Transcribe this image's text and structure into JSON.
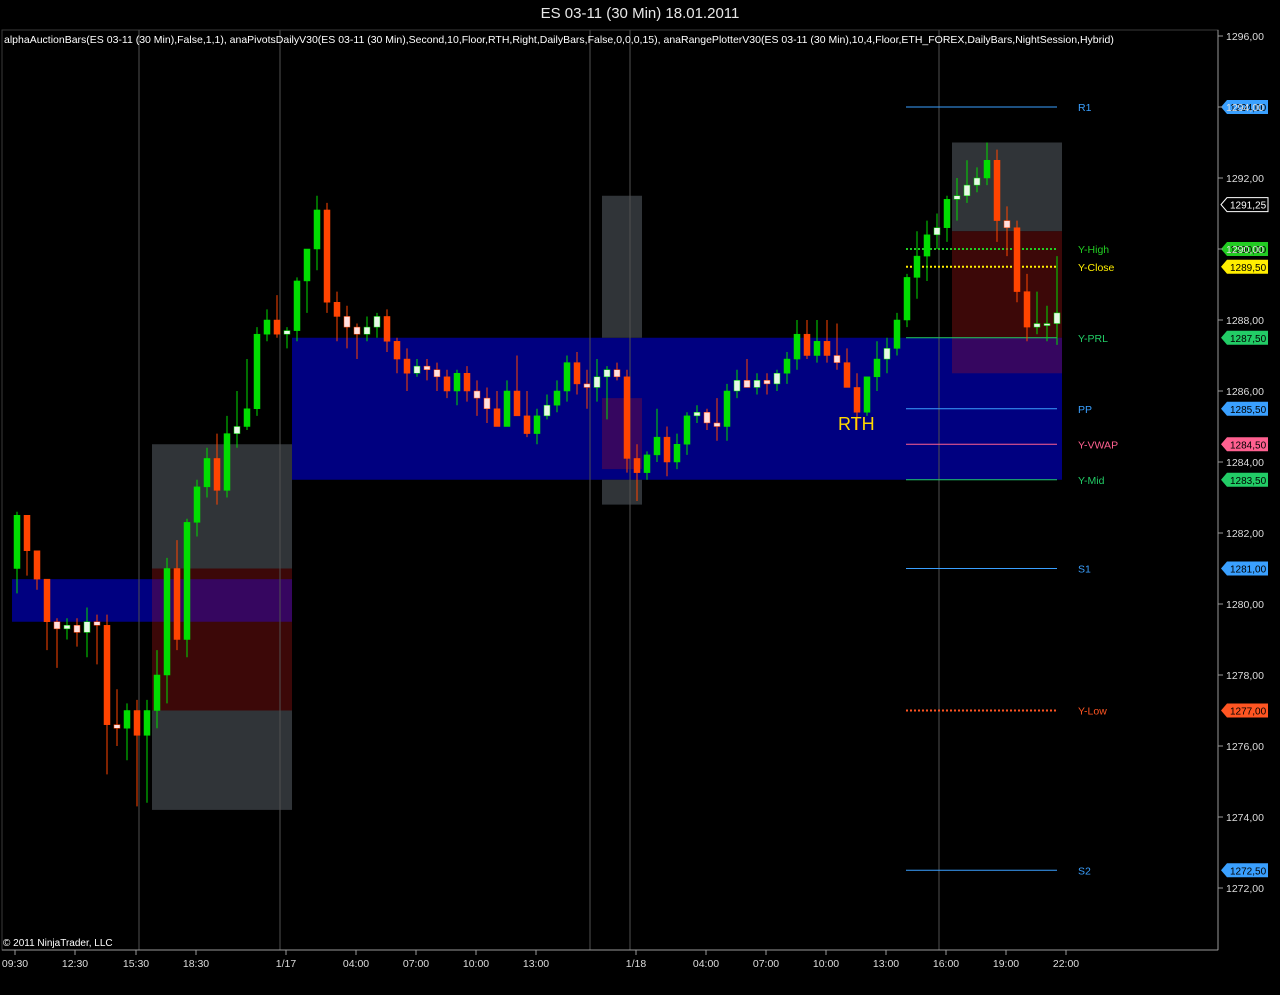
{
  "window": {
    "title": "ES 03-11 (30 Min)  18.01.2011"
  },
  "indicators_line": "alphaAuctionBars(ES 03-11 (30 Min),False,1,1),  anaPivotsDailyV30(ES 03-11 (30 Min),Second,10,Floor,RTH,Right,DailyBars,False,0,0,0,15),  anaRangePlotterV30(ES 03-11 (30 Min),10,4,Floor,ETH_FOREX,DailyBars,NightSession,Hybrid)",
  "copyright": "© 2011 NinjaTrader, LLC",
  "session_label": "RTH",
  "colors": {
    "up": "#00dd00",
    "down": "#ff4400",
    "doji_up": "#ffe0e0",
    "grid_line": "#505050",
    "axis": "#999999",
    "rth_band": "#000080",
    "eth_upper": "#303438",
    "eth_mid": "#3c0808",
    "overlap": "#360660"
  },
  "chart_data": {
    "type": "candlestick",
    "title": "ES 03-11 (30 Min)  18.01.2011",
    "y_axis": {
      "min": 1271,
      "max": 1297,
      "ticks": [
        1272,
        1274,
        1276,
        1278,
        1280,
        1282,
        1284,
        1286,
        1288,
        1290,
        1292,
        1294,
        1296
      ],
      "tick_labels": [
        "1272,00",
        "1274,00",
        "1276,00",
        "1278,00",
        "1280,00",
        "1282,00",
        "1284,00",
        "1286,00",
        "1288,00",
        "1290,00",
        "1292,00",
        "1294,00",
        "1296,00"
      ]
    },
    "x_axis": {
      "labels": [
        "09:30",
        "12:30",
        "15:30",
        "18:30",
        "1/17",
        "04:00",
        "07:00",
        "10:00",
        "13:00",
        "1/18",
        "04:00",
        "07:00",
        "10:00",
        "13:00",
        "16:00",
        "19:00",
        "22:00"
      ]
    },
    "last_price": {
      "value": 1291.25,
      "label": "1291,25"
    },
    "pivot_levels": [
      {
        "name": "R1",
        "value": 1294.0,
        "label": "1294,00",
        "color": "#3aa0ff",
        "style": "solid"
      },
      {
        "name": "Y-High",
        "value": 1290.0,
        "label": "1290,00",
        "color": "#22cc22",
        "style": "dotted"
      },
      {
        "name": "Y-Close",
        "value": 1289.5,
        "label": "1289,50",
        "color": "#ffee00",
        "style": "dotted"
      },
      {
        "name": "Y-PRL",
        "value": 1287.5,
        "label": "1287,50",
        "color": "#22cc66",
        "style": "solid"
      },
      {
        "name": "PP",
        "value": 1285.5,
        "label": "1285,50",
        "color": "#3aa0ff",
        "style": "solid"
      },
      {
        "name": "Y-VWAP",
        "value": 1284.5,
        "label": "1284,50",
        "color": "#ff6090",
        "style": "solid"
      },
      {
        "name": "Y-Mid",
        "value": 1283.5,
        "label": "1283,50",
        "color": "#22cc66",
        "style": "solid"
      },
      {
        "name": "S1",
        "value": 1281.0,
        "label": "1281,00",
        "color": "#3aa0ff",
        "style": "solid"
      },
      {
        "name": "Y-Low",
        "value": 1277.0,
        "label": "1277,00",
        "color": "#ff5522",
        "style": "dotted"
      },
      {
        "name": "S2",
        "value": 1272.5,
        "label": "1272,50",
        "color": "#3aa0ff",
        "style": "solid"
      }
    ],
    "session_boxes": [
      {
        "bars": [
          -0.5,
          13.5
        ],
        "y": [
          1279.5,
          1280.7
        ],
        "kind": "rth"
      },
      {
        "bars": [
          13.5,
          27.5
        ],
        "y": [
          1281.0,
          1284.5
        ],
        "kind": "eth_upper"
      },
      {
        "bars": [
          13.5,
          27.5
        ],
        "y": [
          1277.0,
          1281.0
        ],
        "kind": "eth_mid"
      },
      {
        "bars": [
          13.5,
          27.5
        ],
        "y": [
          1274.2,
          1277.0
        ],
        "kind": "eth_upper"
      },
      {
        "bars": [
          13.5,
          27.5
        ],
        "y": [
          1279.5,
          1280.7
        ],
        "kind": "overlap"
      },
      {
        "bars": [
          27.5,
          104.5
        ],
        "y": [
          1283.5,
          1287.5
        ],
        "kind": "rth"
      },
      {
        "bars": [
          58.5,
          62.5
        ],
        "y": [
          1287.5,
          1291.5
        ],
        "kind": "eth_upper"
      },
      {
        "bars": [
          58.5,
          62.5
        ],
        "y": [
          1282.8,
          1283.5
        ],
        "kind": "eth_upper"
      },
      {
        "bars": [
          58.5,
          62.5
        ],
        "y": [
          1283.8,
          1285.8
        ],
        "kind": "overlap"
      },
      {
        "bars": [
          93.5,
          104.5
        ],
        "y": [
          1290.5,
          1293.0
        ],
        "kind": "eth_upper"
      },
      {
        "bars": [
          93.5,
          104.5
        ],
        "y": [
          1287.5,
          1290.5
        ],
        "kind": "eth_mid"
      },
      {
        "bars": [
          93.5,
          104.5
        ],
        "y": [
          1286.5,
          1287.5
        ],
        "kind": "overlap"
      }
    ],
    "candles": [
      [
        1281.0,
        1282.6,
        1280.3,
        1282.5
      ],
      [
        1282.5,
        1282.5,
        1280.8,
        1281.5
      ],
      [
        1281.5,
        1281.5,
        1280.4,
        1280.7
      ],
      [
        1280.7,
        1280.7,
        1278.7,
        1279.5
      ],
      [
        1279.5,
        1279.6,
        1278.2,
        1279.3
      ],
      [
        1279.3,
        1279.6,
        1279.0,
        1279.4
      ],
      [
        1279.4,
        1279.6,
        1278.8,
        1279.2
      ],
      [
        1279.2,
        1279.9,
        1278.5,
        1279.5
      ],
      [
        1279.5,
        1279.7,
        1278.3,
        1279.4
      ],
      [
        1279.4,
        1279.7,
        1275.2,
        1276.6
      ],
      [
        1276.6,
        1277.6,
        1276.0,
        1276.5
      ],
      [
        1276.5,
        1277.2,
        1275.6,
        1277.0
      ],
      [
        1277.0,
        1277.3,
        1274.3,
        1276.3
      ],
      [
        1276.3,
        1277.3,
        1274.4,
        1277.0
      ],
      [
        1277.0,
        1278.7,
        1276.5,
        1278.0
      ],
      [
        1278.0,
        1281.3,
        1277.2,
        1281.0
      ],
      [
        1281.0,
        1281.8,
        1278.7,
        1279.0
      ],
      [
        1279.0,
        1282.4,
        1278.5,
        1282.3
      ],
      [
        1282.3,
        1283.5,
        1281.9,
        1283.3
      ],
      [
        1283.3,
        1284.4,
        1283.0,
        1284.1
      ],
      [
        1284.1,
        1284.8,
        1282.8,
        1283.2
      ],
      [
        1283.2,
        1285.3,
        1283.0,
        1284.8
      ],
      [
        1284.8,
        1286.0,
        1284.4,
        1285.0
      ],
      [
        1285.0,
        1286.9,
        1284.9,
        1285.5
      ],
      [
        1285.5,
        1287.8,
        1285.3,
        1287.6
      ],
      [
        1287.6,
        1288.3,
        1287.4,
        1288.0
      ],
      [
        1288.0,
        1288.7,
        1287.5,
        1287.6
      ],
      [
        1287.6,
        1287.8,
        1287.2,
        1287.7
      ],
      [
        1287.7,
        1289.2,
        1287.4,
        1289.1
      ],
      [
        1289.1,
        1290.0,
        1288.2,
        1290.0
      ],
      [
        1290.0,
        1291.5,
        1289.4,
        1291.1
      ],
      [
        1291.1,
        1291.3,
        1288.2,
        1288.5
      ],
      [
        1288.5,
        1288.8,
        1287.4,
        1288.1
      ],
      [
        1288.1,
        1288.4,
        1287.2,
        1287.8
      ],
      [
        1287.8,
        1287.9,
        1286.9,
        1287.6
      ],
      [
        1287.6,
        1288.1,
        1287.4,
        1287.8
      ],
      [
        1287.8,
        1288.2,
        1287.5,
        1288.1
      ],
      [
        1288.1,
        1288.3,
        1287.1,
        1287.4
      ],
      [
        1287.4,
        1287.5,
        1286.5,
        1286.9
      ],
      [
        1286.9,
        1287.2,
        1286.0,
        1286.5
      ],
      [
        1286.5,
        1286.9,
        1286.4,
        1286.7
      ],
      [
        1286.7,
        1286.9,
        1286.3,
        1286.6
      ],
      [
        1286.6,
        1286.8,
        1286.0,
        1286.4
      ],
      [
        1286.4,
        1286.6,
        1285.8,
        1286.0
      ],
      [
        1286.0,
        1286.6,
        1285.6,
        1286.5
      ],
      [
        1286.5,
        1286.7,
        1285.7,
        1286.0
      ],
      [
        1286.0,
        1286.3,
        1285.3,
        1285.8
      ],
      [
        1285.8,
        1286.1,
        1285.1,
        1285.5
      ],
      [
        1285.5,
        1286.0,
        1285.1,
        1285.0
      ],
      [
        1285.0,
        1286.3,
        1285.0,
        1286.0
      ],
      [
        1286.0,
        1287.0,
        1285.5,
        1285.3
      ],
      [
        1285.3,
        1286.0,
        1284.7,
        1284.8
      ],
      [
        1284.8,
        1285.5,
        1284.5,
        1285.3
      ],
      [
        1285.3,
        1285.9,
        1285.2,
        1285.6
      ],
      [
        1285.6,
        1286.3,
        1285.4,
        1286.0
      ],
      [
        1286.0,
        1287.0,
        1285.7,
        1286.8
      ],
      [
        1286.8,
        1287.1,
        1285.9,
        1286.2
      ],
      [
        1286.2,
        1286.6,
        1285.5,
        1286.1
      ],
      [
        1286.1,
        1286.9,
        1285.7,
        1286.4
      ],
      [
        1286.4,
        1286.7,
        1285.2,
        1286.6
      ],
      [
        1286.6,
        1286.8,
        1286.3,
        1286.4
      ],
      [
        1286.4,
        1286.6,
        1283.7,
        1284.1
      ],
      [
        1284.1,
        1284.5,
        1282.9,
        1283.7
      ],
      [
        1283.7,
        1284.3,
        1283.5,
        1284.2
      ],
      [
        1284.2,
        1285.5,
        1284.0,
        1284.7
      ],
      [
        1284.7,
        1285.0,
        1283.6,
        1284.0
      ],
      [
        1284.0,
        1284.8,
        1283.8,
        1284.5
      ],
      [
        1284.5,
        1285.4,
        1284.2,
        1285.3
      ],
      [
        1285.3,
        1285.6,
        1285.1,
        1285.4
      ],
      [
        1285.4,
        1285.5,
        1284.9,
        1285.1
      ],
      [
        1285.1,
        1285.8,
        1284.6,
        1285.0
      ],
      [
        1285.0,
        1286.2,
        1284.6,
        1286.0
      ],
      [
        1286.0,
        1286.6,
        1285.8,
        1286.3
      ],
      [
        1286.3,
        1286.9,
        1286.1,
        1286.1
      ],
      [
        1286.1,
        1286.5,
        1285.9,
        1286.3
      ],
      [
        1286.3,
        1286.5,
        1285.9,
        1286.2
      ],
      [
        1286.2,
        1286.6,
        1286.0,
        1286.5
      ],
      [
        1286.5,
        1287.1,
        1286.2,
        1286.9
      ],
      [
        1286.9,
        1288.0,
        1286.6,
        1287.6
      ],
      [
        1287.6,
        1288.0,
        1286.9,
        1287.0
      ],
      [
        1287.0,
        1288.0,
        1286.8,
        1287.4
      ],
      [
        1287.4,
        1288.0,
        1286.8,
        1287.0
      ],
      [
        1287.0,
        1287.9,
        1286.6,
        1286.8
      ],
      [
        1286.8,
        1287.2,
        1286.3,
        1286.1
      ],
      [
        1286.1,
        1286.5,
        1284.9,
        1285.4
      ],
      [
        1285.4,
        1286.4,
        1285.3,
        1286.4
      ],
      [
        1286.4,
        1287.4,
        1286.0,
        1286.9
      ],
      [
        1286.9,
        1287.5,
        1286.5,
        1287.2
      ],
      [
        1287.2,
        1288.2,
        1287.0,
        1288.0
      ],
      [
        1288.0,
        1289.3,
        1287.8,
        1289.2
      ],
      [
        1289.2,
        1290.5,
        1288.6,
        1289.8
      ],
      [
        1289.8,
        1290.8,
        1289.1,
        1290.4
      ],
      [
        1290.4,
        1291.0,
        1290.0,
        1290.6
      ],
      [
        1290.6,
        1291.5,
        1290.2,
        1291.4
      ],
      [
        1291.4,
        1292.0,
        1290.8,
        1291.5
      ],
      [
        1291.5,
        1292.5,
        1291.3,
        1291.8
      ],
      [
        1291.8,
        1292.3,
        1291.6,
        1292.0
      ],
      [
        1292.0,
        1293.0,
        1291.8,
        1292.5
      ],
      [
        1292.5,
        1292.8,
        1290.2,
        1290.8
      ],
      [
        1290.8,
        1291.2,
        1289.8,
        1290.6
      ],
      [
        1290.6,
        1290.8,
        1288.5,
        1288.8
      ],
      [
        1288.8,
        1289.3,
        1287.4,
        1287.8
      ],
      [
        1287.8,
        1288.8,
        1287.6,
        1287.9
      ],
      [
        1287.9,
        1288.4,
        1287.4,
        1287.9
      ],
      [
        1287.9,
        1289.8,
        1287.3,
        1288.2
      ]
    ]
  }
}
